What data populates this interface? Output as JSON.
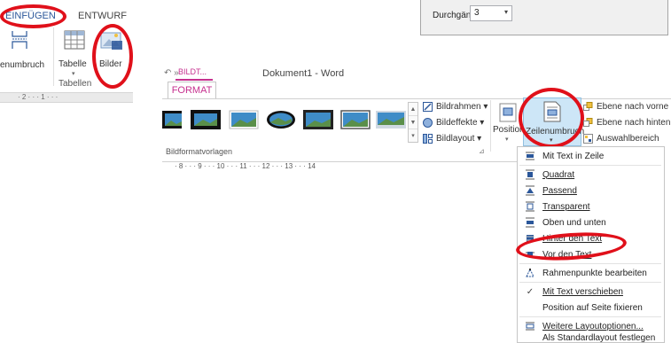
{
  "left_ribbon": {
    "tabs": [
      "EINFÜGEN",
      "ENTWURF"
    ],
    "partial_label": "enumbruch",
    "tabelle_label": "Tabelle",
    "bilder_label": "Bilder",
    "group_label": "Tabellen",
    "ruler_text": "· 2 · · · 1 · · ·"
  },
  "dialog": {
    "label": "Durchgänge:",
    "value": "3"
  },
  "window": {
    "qat_text": "↶ »",
    "context_tab": "BILDT...",
    "title": "Dokument1 - Word",
    "active_tab": "FORMAT"
  },
  "ribbon": {
    "commands_right": [
      "Bildrahmen ▾",
      "Bildeffekte ▾",
      "Bildlayout ▾"
    ],
    "position_label": "Position",
    "zeilenumbruch_label": "Zeilenumbruch",
    "arrange": [
      "Ebene nach vorne ▾",
      "Ebene nach hinten",
      "Auswahlbereich"
    ],
    "group_label": "Bildformatvorlagen",
    "ruler_text": "· 8 · · · 9 · · · 10 · · · 11 · · · 12 · · · 13 · · · 14"
  },
  "menu": {
    "items": [
      {
        "label": "Mit Text in Zeile",
        "icon": "wrap-inline-icon"
      },
      {
        "label": "Quadrat",
        "icon": "wrap-square-icon"
      },
      {
        "label": "Passend",
        "icon": "wrap-tight-icon"
      },
      {
        "label": "Transparent",
        "icon": "wrap-through-icon"
      },
      {
        "label": "Oben und unten",
        "icon": "wrap-top-bottom-icon"
      },
      {
        "label": "Hinter den Text",
        "icon": "wrap-behind-icon"
      },
      {
        "label": "Vor den Text",
        "icon": "wrap-front-icon"
      },
      {
        "label": "Rahmenpunkte bearbeiten",
        "icon": "edit-points-icon"
      },
      {
        "label": "Mit Text verschieben",
        "icon": "check-icon"
      },
      {
        "label": "Position auf Seite fixieren",
        "icon": ""
      },
      {
        "label": "Weitere Layoutoptionen...",
        "icon": "layout-options-icon"
      },
      {
        "label": "Als Standardlayout festlegen",
        "icon": ""
      }
    ]
  },
  "colors": {
    "accent": "#c6318f",
    "highlight": "#e0101a",
    "word_blue": "#2b579a"
  }
}
